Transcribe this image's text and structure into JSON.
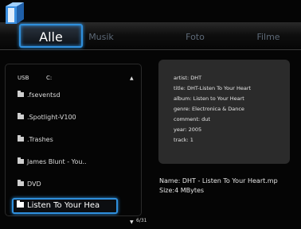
{
  "tabs": [
    "Alle",
    "Musik",
    "Foto",
    "Filme"
  ],
  "path": {
    "device": "USB",
    "drive": "C:"
  },
  "items": [
    ".fseventsd",
    ".Spotlight-V100",
    ".Trashes",
    "James Blunt - You..",
    "DVD"
  ],
  "selected_item": "Listen To Your Hea",
  "page_counter": "6/31",
  "info": [
    "artist: DHT",
    "title: DHT-Listen To Your Heart",
    "album: Listen to Your Heart",
    "genre: Electronica & Dance",
    "comment: dut",
    "year: 2005",
    "track: 1"
  ],
  "file": {
    "name": "Name: DHT - Listen To Your Heart.mp",
    "size": "Size:4 MBytes"
  },
  "icons": {
    "logo": "folder-logo-icon",
    "folder": "folder-icon",
    "scroll_up": "triangle-up-icon",
    "scroll_down": "triangle-down-icon"
  },
  "colors": {
    "accent": "#2f8fdc",
    "panel": "#2b2b2b",
    "tab_inactive": "#5d6977"
  }
}
